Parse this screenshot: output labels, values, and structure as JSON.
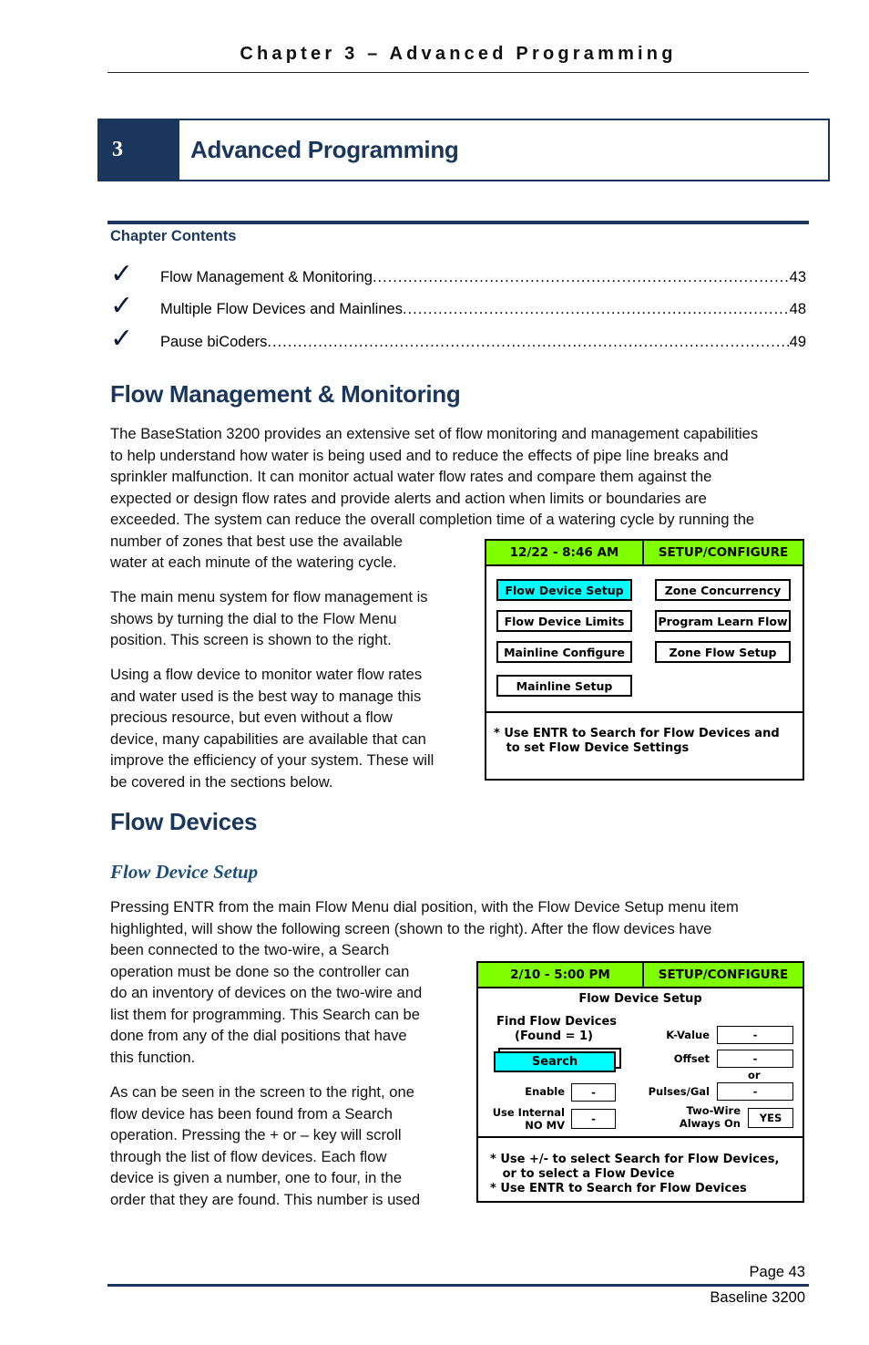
{
  "header": {
    "running_title": "Chapter 3 – Advanced Programming"
  },
  "banner": {
    "number": "3",
    "title": "Advanced Programming"
  },
  "contents": {
    "title": "Chapter Contents",
    "items": [
      {
        "label": "Flow Management & Monitoring ",
        "page": "43"
      },
      {
        "label": "Multiple Flow Devices and Mainlines ",
        "page": "48"
      },
      {
        "label": "Pause biCoders ",
        "page": "49"
      }
    ]
  },
  "section1": {
    "heading": "Flow Management & Monitoring",
    "para1_lines": [
      "The BaseStation 3200 provides an extensive set of flow monitoring and management capabilities",
      "to help understand how water is being used and to reduce the effects of pipe line breaks and",
      "sprinkler malfunction.  It can monitor actual water flow rates and compare them against the",
      "expected or design flow rates and provide alerts and action when limits or boundaries are",
      "exceeded.  The system can reduce the overall completion time of a watering cycle by running the",
      "number of zones that best use the available",
      "water at each minute of the watering cycle."
    ],
    "para2_lines": [
      "The main menu system for flow management is",
      "shows by turning the dial to the Flow Menu",
      "position.   This screen is shown to the right."
    ],
    "para3_lines": [
      "Using a flow device to monitor water flow rates",
      "and water used is the best way to manage this",
      "precious resource, but even without a flow",
      "device, many capabilities are available that can",
      "improve the efficiency of your system.  These will",
      "be covered in the sections below."
    ]
  },
  "screen1": {
    "datetime": "12/22 - 8:46 AM",
    "mode": "SETUP/CONFIGURE",
    "buttons": [
      {
        "label": "Flow Device Setup",
        "selected": true
      },
      {
        "label": "Zone Concurrency",
        "selected": false
      },
      {
        "label": "Flow Device Limits",
        "selected": false
      },
      {
        "label": "Program Learn Flow",
        "selected": false
      },
      {
        "label": "Mainline Configure",
        "selected": false
      },
      {
        "label": "Zone Flow Setup",
        "selected": false
      },
      {
        "label": "Mainline Setup",
        "selected": false
      }
    ],
    "note": "* Use ENTR to Search for Flow Devices and\n   to set Flow Device Settings",
    "colors": {
      "header": "#7fff00",
      "selected": "#00ffff"
    }
  },
  "section2": {
    "heading": "Flow Devices",
    "subheading": "Flow Device Setup",
    "para1_lines": [
      "Pressing ENTR from the main Flow Menu dial position, with the Flow Device Setup menu item",
      "highlighted, will show the following screen (shown to the right).  After the flow devices have",
      "been connected to the two-wire, a Search",
      "operation must be done so the controller can",
      "do an inventory of devices on the two-wire and",
      "list them for programming.  This Search can be",
      "done from any of the dial positions that have",
      "this function."
    ],
    "para2_lines": [
      "As can be seen in the screen to the right, one",
      "flow device has been found from a Search",
      "operation.  Pressing the + or – key will scroll",
      "through the list of flow devices.  Each flow",
      "device is given a number, one to four, in the",
      "order that they are found.  This number is used"
    ]
  },
  "screen2": {
    "datetime": "2/10 - 5:00 PM",
    "mode": "SETUP/CONFIGURE",
    "title": "Flow Device Setup",
    "find_label_1": "Find Flow Devices",
    "find_label_2": "(Found = 1)",
    "search_button": "Search",
    "enable_label": "Enable",
    "enable_value": "-",
    "internal_label_1": "Use Internal",
    "internal_label_2": "NO MV",
    "internal_value": "-",
    "kvalue_label": "K-Value",
    "kvalue_value": "-",
    "offset_label": "Offset",
    "offset_value": "-",
    "or_label": "or",
    "pulses_label": "Pulses/Gal",
    "pulses_value": "-",
    "twowire_label_1": "Two-Wire",
    "twowire_label_2": "Always On",
    "twowire_value": "YES",
    "note": "* Use +/- to select Search for Flow Devices,\n   or to select a Flow Device\n* Use ENTR to Search for Flow Devices"
  },
  "footer": {
    "page": "Page 43",
    "document": "Baseline 3200"
  }
}
